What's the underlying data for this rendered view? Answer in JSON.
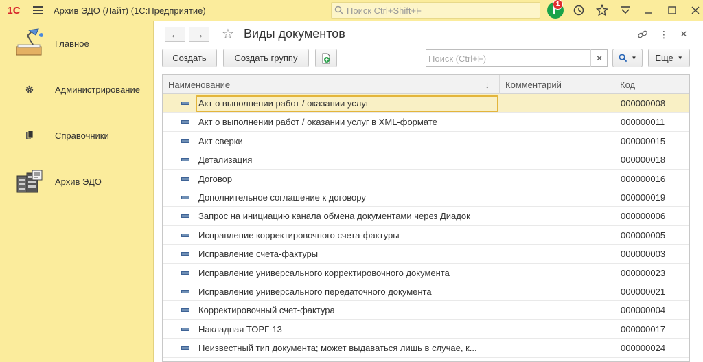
{
  "titlebar": {
    "logo": "1С",
    "title": "Архив ЭДО (Лайт)  (1С:Предприятие)",
    "search_placeholder": "Поиск Ctrl+Shift+F",
    "notification_count": "1"
  },
  "sidebar": {
    "items": [
      {
        "label": "Главное",
        "icon": "desk-lamp-icon"
      },
      {
        "label": "Администрирование",
        "icon": "gear-icon"
      },
      {
        "label": "Справочники",
        "icon": "books-icon"
      },
      {
        "label": "Архив ЭДО",
        "icon": "archive-icon"
      }
    ]
  },
  "form": {
    "title": "Виды документов",
    "create_label": "Создать",
    "create_group_label": "Создать группу",
    "search_placeholder": "Поиск (Ctrl+F)",
    "more_label": "Еще"
  },
  "table": {
    "columns": [
      "Наименование",
      "Комментарий",
      "Код"
    ],
    "sort_indicator": "↓",
    "rows": [
      {
        "name": "Акт о выполнении работ / оказании услуг",
        "comment": "",
        "code": "000000008"
      },
      {
        "name": "Акт о выполнении работ / оказании услуг в XML-формате",
        "comment": "",
        "code": "000000011"
      },
      {
        "name": "Акт сверки",
        "comment": "",
        "code": "000000015"
      },
      {
        "name": "Детализация",
        "comment": "",
        "code": "000000018"
      },
      {
        "name": "Договор",
        "comment": "",
        "code": "000000016"
      },
      {
        "name": "Дополнительное соглашение к договору",
        "comment": "",
        "code": "000000019"
      },
      {
        "name": "Запрос на инициацию канала обмена документами через Диадок",
        "comment": "",
        "code": "000000006"
      },
      {
        "name": "Исправление корректировочного счета-фактуры",
        "comment": "",
        "code": "000000005"
      },
      {
        "name": "Исправление счета-фактуры",
        "comment": "",
        "code": "000000003"
      },
      {
        "name": "Исправление универсального корректировочного документа",
        "comment": "",
        "code": "000000023"
      },
      {
        "name": "Исправление универсального передаточного документа",
        "comment": "",
        "code": "000000021"
      },
      {
        "name": "Корректировочный счет-фактура",
        "comment": "",
        "code": "000000004"
      },
      {
        "name": "Накладная ТОРГ-13",
        "comment": "",
        "code": "000000017"
      },
      {
        "name": "Неизвестный тип документа; может выдаваться лишь в случае, к...",
        "comment": "",
        "code": "000000024"
      }
    ]
  },
  "colors": {
    "accent": "#fbec9c",
    "selection": "#f9f0c5",
    "focus": "#e3b53b"
  }
}
